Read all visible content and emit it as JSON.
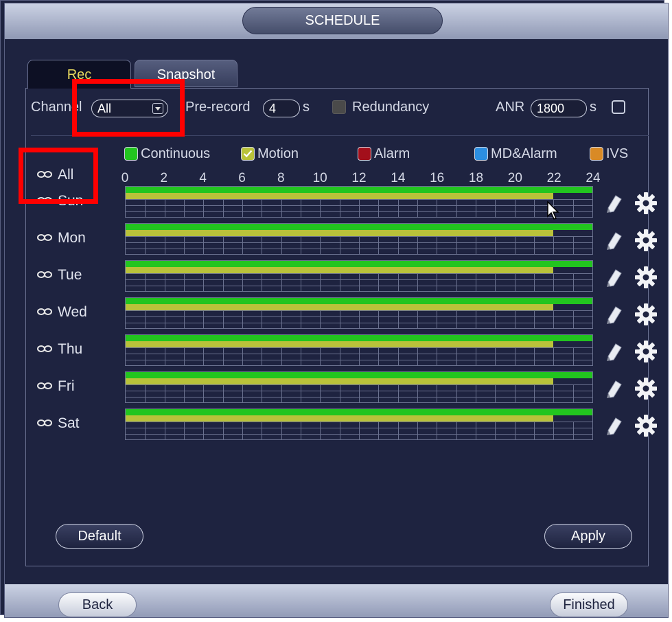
{
  "window": {
    "title": "SCHEDULE"
  },
  "tabs": [
    {
      "label": "Rec",
      "active": true
    },
    {
      "label": "Snapshot",
      "active": false
    }
  ],
  "channel": {
    "label": "Channel",
    "value": "All"
  },
  "prerecord": {
    "label": "Pre-record",
    "value": "4",
    "unit": "s"
  },
  "redundancy": {
    "label": "Redundancy",
    "checked": false
  },
  "anr": {
    "label": "ANR",
    "value": "1800",
    "unit": "s",
    "checked": false
  },
  "legend": [
    {
      "label": "Continuous",
      "color": "#22c51f",
      "checked": false
    },
    {
      "label": "Motion",
      "color": "#b9c23a",
      "checked": true
    },
    {
      "label": "Alarm",
      "color": "#a30f1b",
      "checked": false
    },
    {
      "label": "MD&Alarm",
      "color": "#2c8ee0",
      "checked": false
    },
    {
      "label": "IVS",
      "color": "#d98a25",
      "checked": false
    }
  ],
  "hours": [
    "0",
    "2",
    "4",
    "6",
    "8",
    "10",
    "12",
    "14",
    "16",
    "18",
    "20",
    "22",
    "24"
  ],
  "all_label": "All",
  "days": [
    {
      "label": "Sun",
      "continuous_end_h": 24,
      "motion_end_h": 22
    },
    {
      "label": "Mon",
      "continuous_end_h": 24,
      "motion_end_h": 22
    },
    {
      "label": "Tue",
      "continuous_end_h": 24,
      "motion_end_h": 22
    },
    {
      "label": "Wed",
      "continuous_end_h": 24,
      "motion_end_h": 22
    },
    {
      "label": "Thu",
      "continuous_end_h": 24,
      "motion_end_h": 22
    },
    {
      "label": "Fri",
      "continuous_end_h": 24,
      "motion_end_h": 22
    },
    {
      "label": "Sat",
      "continuous_end_h": 24,
      "motion_end_h": 22
    }
  ],
  "buttons": {
    "default": "Default",
    "apply": "Apply",
    "back": "Back",
    "finished": "Finished"
  },
  "icons": {
    "link": "link-icon",
    "edit": "pencil-icon",
    "settings": "gear-icon",
    "cursor": "mouse-cursor"
  }
}
